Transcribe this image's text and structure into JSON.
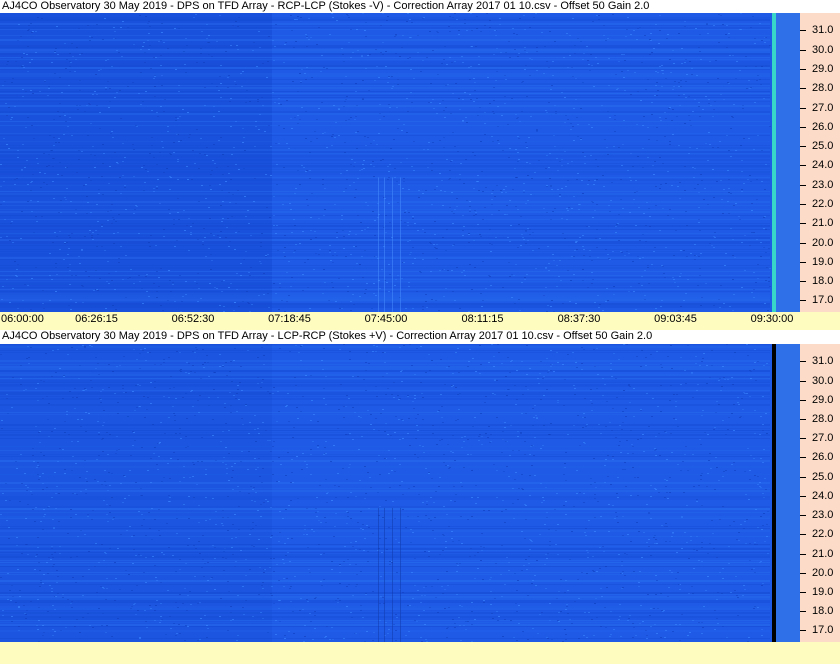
{
  "chart_data": [
    {
      "type": "heatmap",
      "title": "AJ4CO Observatory 30 May 2019  -  DPS on TFD Array  -  RCP-LCP (Stokes -V)  -  Correction Array 2017 01 10.csv  -  Offset 50  Gain 2.0",
      "y_tick_labels": [
        "31.0",
        "30.0",
        "29.0",
        "28.0",
        "27.0",
        "26.0",
        "25.0",
        "24.0",
        "23.0",
        "22.0",
        "21.0",
        "20.0",
        "19.0",
        "18.0",
        "17.0"
      ],
      "x_tick_labels": [
        "06:00:00",
        "06:26:15",
        "06:52:30",
        "07:18:45",
        "07:45:00",
        "08:11:15",
        "08:37:30",
        "09:03:45",
        "09:30:00"
      ],
      "ylim": [
        16.4,
        31.9
      ],
      "colormap": "blue",
      "end_marker": "cyan-line"
    },
    {
      "type": "heatmap",
      "title": "AJ4CO Observatory 30 May 2019  -  DPS on TFD Array  -  LCP-RCP (Stokes +V)  -  Correction Array 2017 01 10.csv  -  Offset 50  Gain 2.0",
      "y_tick_labels": [
        "31.0",
        "30.0",
        "29.0",
        "28.0",
        "27.0",
        "26.0",
        "25.0",
        "24.0",
        "23.0",
        "22.0",
        "21.0",
        "20.0",
        "19.0",
        "18.0",
        "17.0"
      ],
      "ylim": [
        16.4,
        31.9
      ],
      "colormap": "blue",
      "end_marker": "black-line"
    }
  ],
  "colors": {
    "axis_bg": "#fcdcc8",
    "time_bar_bg": "#fffcc0",
    "field_base": "#1e5ae6",
    "field_dark": "#1448d0",
    "field_light": "#2a70f0"
  }
}
